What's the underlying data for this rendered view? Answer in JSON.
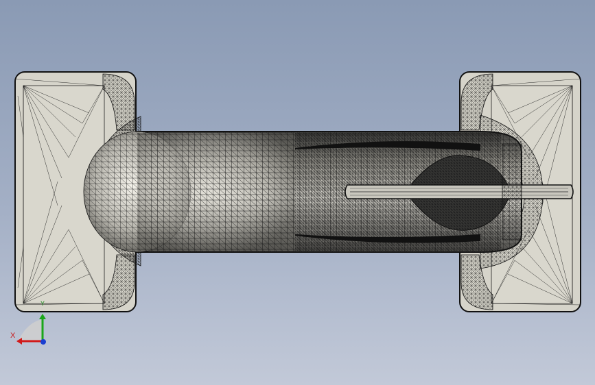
{
  "viewport": {
    "background_top": "#8a9ab4",
    "background_bottom": "#c2c9d8",
    "model": {
      "name": "mesh-part",
      "shading": "wireframe-over-shaded",
      "fill_color": "#d8d6cc",
      "edge_color": "#111111"
    }
  },
  "triad": {
    "x_label": "X",
    "y_label": "Y",
    "x_color": "#d11a1a",
    "y_color": "#1aa61a",
    "z_color": "#1a3fd1"
  }
}
